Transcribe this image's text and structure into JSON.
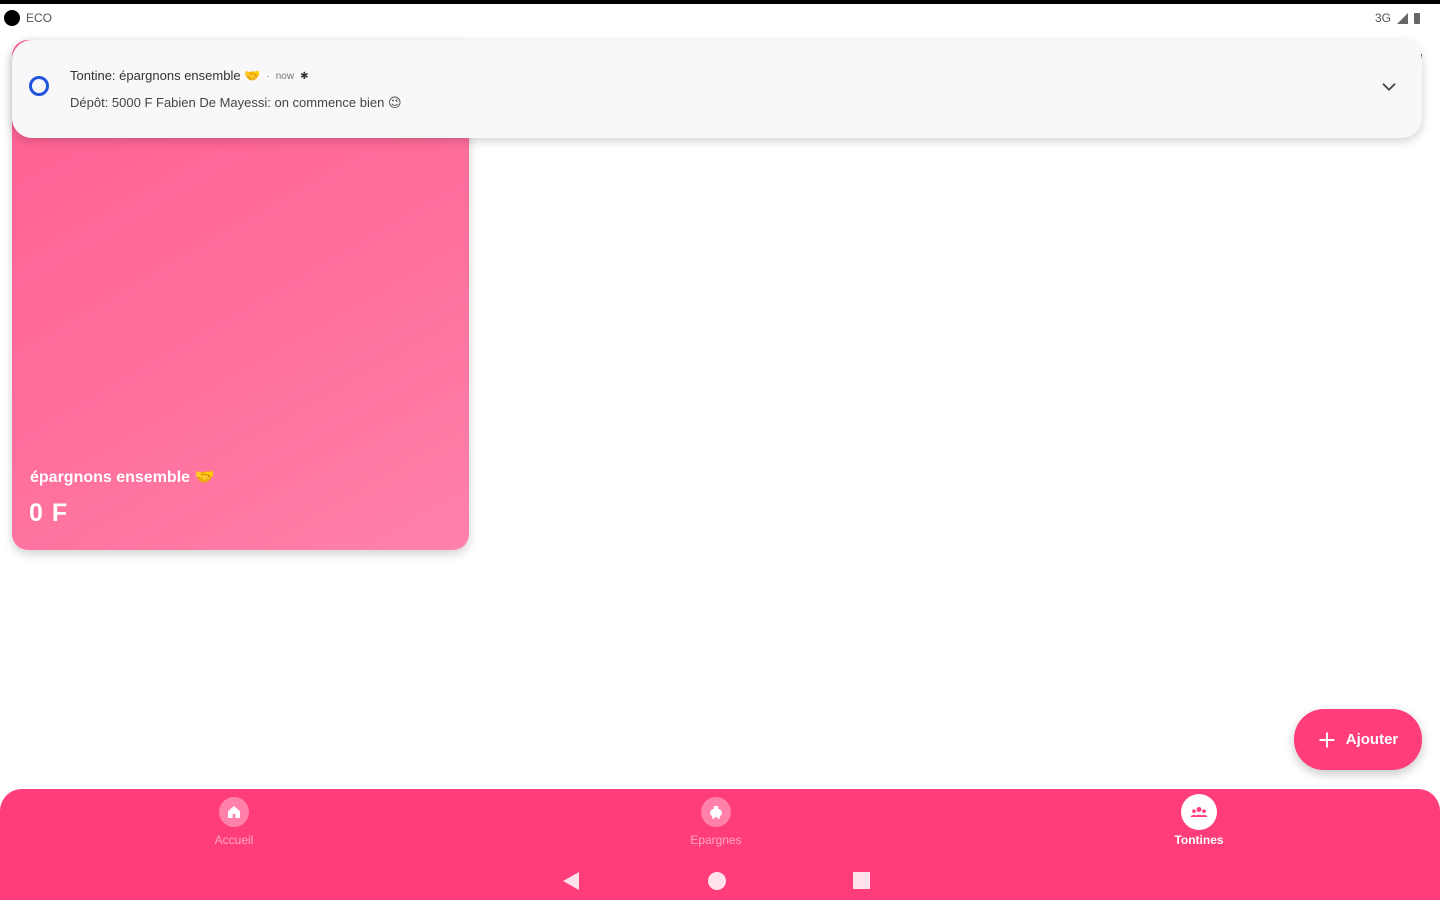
{
  "status_bar": {
    "carrier": "ECO",
    "network": "3G"
  },
  "notification": {
    "app_title": "Tontine: épargnons ensemble 🤝",
    "separator": "·",
    "time": "now",
    "message": "Dépôt: 5000 F Fabien De Mayessi: on commence bien 😉"
  },
  "card": {
    "title": "épargnons ensemble 🤝",
    "amount": "0 F"
  },
  "fab": {
    "label": "Ajouter"
  },
  "bottom_nav": {
    "items": [
      {
        "label": "Accueil"
      },
      {
        "label": "Epargnes"
      },
      {
        "label": "Tontines"
      }
    ],
    "active_index": 2
  },
  "colors": {
    "primary": "#ff3d7a",
    "card": "#ff6f9c",
    "notification_bg": "#f8f8fa"
  }
}
